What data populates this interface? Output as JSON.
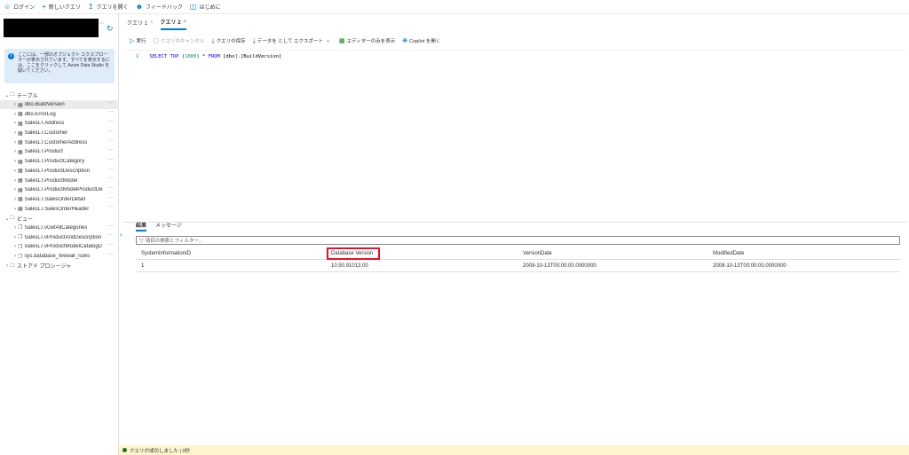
{
  "toolbar": {
    "items": [
      {
        "label": "ログイン",
        "icon": "person-icon"
      },
      {
        "label": "新しいクエリ",
        "icon": "plus-icon"
      },
      {
        "label": "クエリを開く",
        "icon": "upload-icon"
      },
      {
        "label": "フィードバック",
        "icon": "feedback-icon"
      },
      {
        "label": "はじめに",
        "icon": "book-icon"
      }
    ]
  },
  "sidebar": {
    "more": "···",
    "info_text": "ここには、一部のオブジェクト エクスプローラーが表示されています。すべてを表示するには、ここをクリックして Azure Data Studio を開いてください。",
    "tables_label": "テーブル",
    "tables": [
      "dbo.BuildVersion",
      "dbo.ErrorLog",
      "SalesLT.Address",
      "SalesLT.Customer",
      "SalesLT.CustomerAddress",
      "SalesLT.Product",
      "SalesLT.ProductCategory",
      "SalesLT.ProductDescription",
      "SalesLT.ProductModel",
      "SalesLT.ProductModelProductDe",
      "SalesLT.SalesOrderDetail",
      "SalesLT.SalesOrderHeader"
    ],
    "views_label": "ビュー",
    "views": [
      "SalesLT.vGetAllCategories",
      "SalesLT.vProductAndDescription",
      "SalesLT.vProductModelCatalogD",
      "sys.database_firewall_rules"
    ],
    "procs_label": "ストアド プロシージャ"
  },
  "tabs": [
    {
      "label": "クエリ 1"
    },
    {
      "label": "クエリ 2"
    }
  ],
  "query_toolbar": {
    "run": "実行",
    "cancel": "クエリのキャンセル",
    "save": "クエリの保存",
    "export": "データを として エクスポート",
    "editor_only": "エディターのみを表示",
    "copilot": "Copilot を開く"
  },
  "editor": {
    "line_number": "1",
    "kw_select": "SELECT",
    "kw_top": "TOP",
    "paren_open": "(",
    "num": "1000",
    "rest1": ") * ",
    "kw_from": "FROM",
    "rest2": " [dbo].[BuildVersion]"
  },
  "results": {
    "tab_results": "結果",
    "tab_messages": "メッセージ",
    "filter_placeholder": "項目の検索とフィルター...",
    "columns": [
      "SystemInformationID",
      "Database Version",
      "VersionDate",
      "ModifiedDate"
    ],
    "rows": [
      [
        "1",
        "10.50.91013.00",
        "2009-10-13T00:00:00.0000000",
        "2009-10-13T00:00:00.0000000"
      ]
    ]
  },
  "status": {
    "text": "クエリが成功しました | 0秒",
    "color": "#107c10"
  }
}
